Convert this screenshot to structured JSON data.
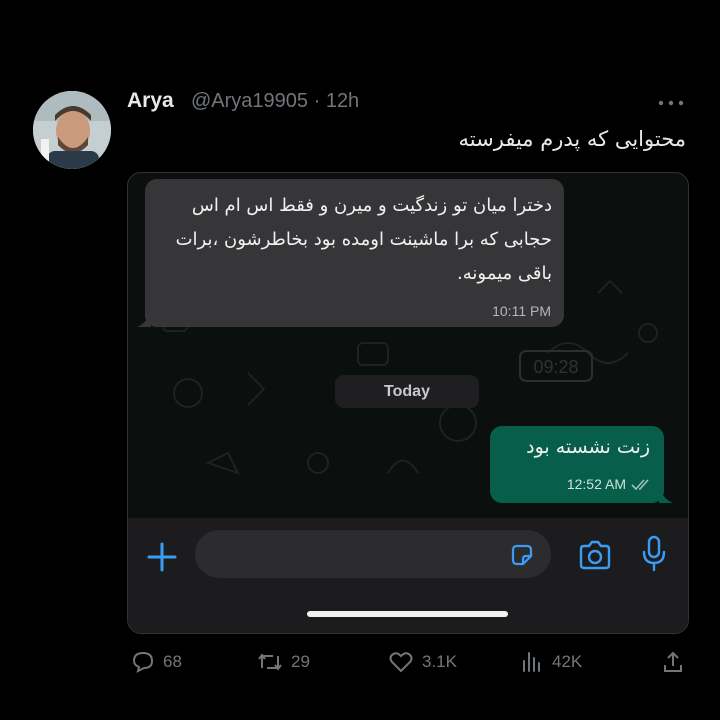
{
  "tweet": {
    "author_name": "Arya",
    "handle_time": "@Arya19905 · 12h",
    "text": "محتوایی که پدرم میفرسته"
  },
  "chat": {
    "incoming_message": "دخترا میان تو زندگیت و میرن و فقط اس ام اس حجابی که برا ماشینت اومده بود بخاطرشون ،برات باقی میمونه.",
    "incoming_time": "10:11 PM",
    "date_divider": "Today",
    "outgoing_message": "زنت نشسته بود",
    "outgoing_time": "12:52 AM",
    "wallpaper_clock_text": "09:28"
  },
  "stats": {
    "replies": "68",
    "retweets": "29",
    "likes": "3.1K",
    "views": "42K"
  },
  "icons": [
    "more-icon",
    "reply-icon",
    "retweet-icon",
    "like-icon",
    "views-icon",
    "share-icon",
    "plus-icon",
    "sticker-icon",
    "camera-icon",
    "mic-icon",
    "read-checks-icon"
  ],
  "colors": {
    "background": "#000000",
    "outgoing_bubble": "#075e4a",
    "incoming_bubble": "#363638",
    "accent_blue": "#3b9cf5",
    "muted_text": "#71767b"
  }
}
